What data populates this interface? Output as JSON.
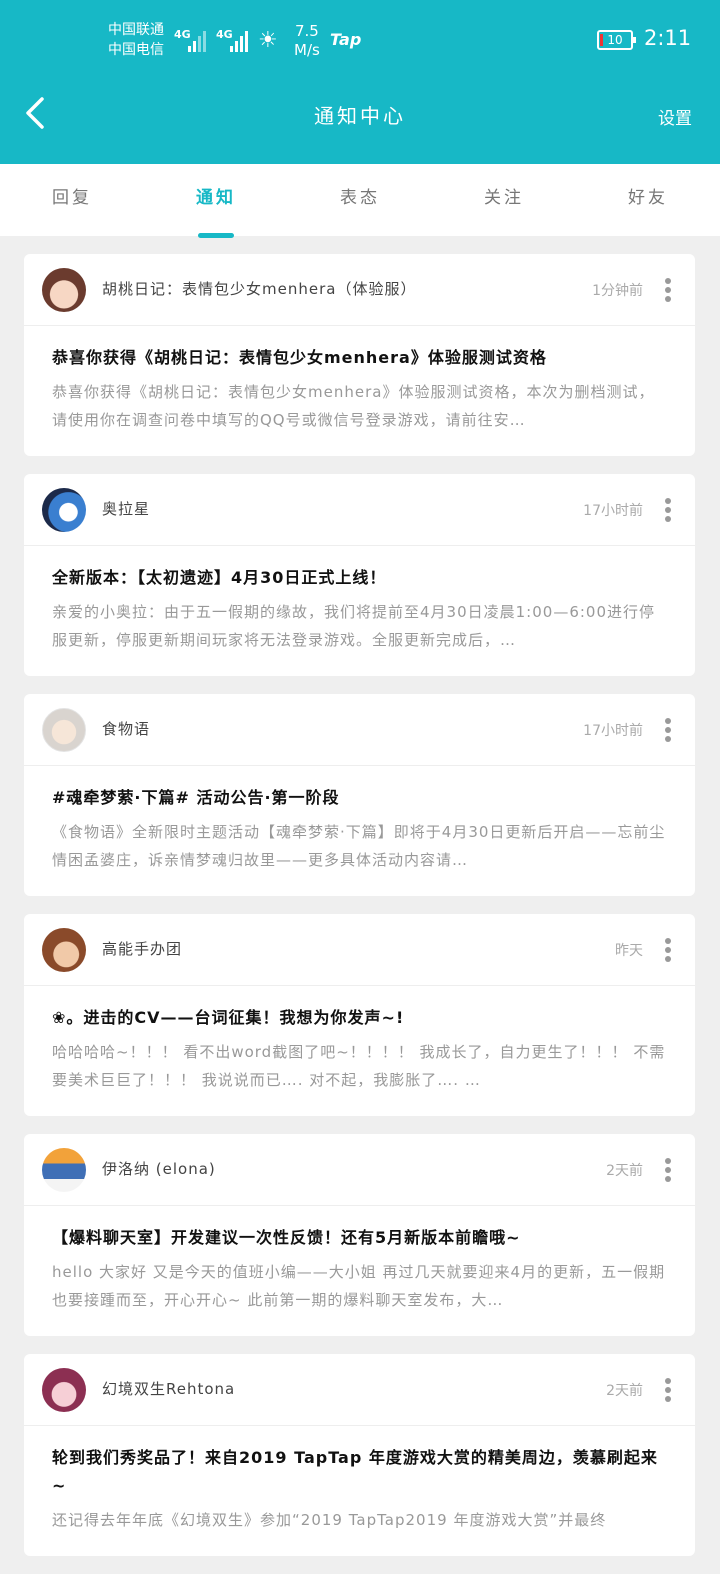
{
  "status_bar": {
    "carrier1": "中国联通",
    "carrier2": "中国电信",
    "sig1": "4G",
    "sig2": "4G",
    "speed_value": "7.5",
    "speed_unit": "M/s",
    "tap_label": "Tap",
    "battery": "10",
    "time": "2:11"
  },
  "header": {
    "back_icon": "chevron-left-icon",
    "title": "通知中心",
    "settings_label": "设置"
  },
  "tabs": [
    {
      "label": "回复"
    },
    {
      "label": "通知"
    },
    {
      "label": "表态"
    },
    {
      "label": "关注"
    },
    {
      "label": "好友"
    }
  ],
  "active_tab": "通知",
  "colors": {
    "accent": "#17b8c6"
  },
  "notifications": [
    {
      "sender": "胡桃日记：表情包少女menhera（体验服）",
      "time": "1分钟前",
      "title": "恭喜你获得《胡桃日记：表情包少女menhera》体验服测试资格",
      "text": "恭喜你获得《胡桃日记：表情包少女menhera》体验服测试资格，本次为删档测试，请使用你在调查问卷中填写的QQ号或微信号登录游戏，请前往安…"
    },
    {
      "sender": "奥拉星",
      "time": "17小时前",
      "title": "全新版本：【太初遗迹】4月30日正式上线！",
      "text": "亲爱的小奥拉：由于五一假期的缘故，我们将提前至4月30日凌晨1:00—6:00进行停服更新，停服更新期间玩家将无法登录游戏。全服更新完成后，…"
    },
    {
      "sender": "食物语",
      "time": "17小时前",
      "title": "#魂牵梦萦·下篇# 活动公告·第一阶段",
      "text": "《食物语》全新限时主题活动【魂牵梦萦·下篇】即将于4月30日更新后开启——忘前尘情困孟婆庄，诉亲情梦魂归故里——更多具体活动内容请…"
    },
    {
      "sender": "高能手办团",
      "time": "昨天",
      "title": "❀。进击的CV——台词征集！我想为你发声~!",
      "text": "哈哈哈哈~！！！ 看不出word截图了吧~！！！！ 我成长了，自力更生了！！！ 不需要美术巨巨了！！！ 我说说而已…. 对不起，我膨胀了…. …"
    },
    {
      "sender": "伊洛纳 (elona)",
      "time": "2天前",
      "title": "【爆料聊天室】开发建议一次性反馈！还有5月新版本前瞻哦~",
      "text": "hello 大家好 又是今天的值班小编——大小姐 再过几天就要迎来4月的更新，五一假期也要接踵而至，开心开心~ 此前第一期的爆料聊天室发布，大…"
    },
    {
      "sender": "幻境双生Rehtona",
      "time": "2天前",
      "title": "轮到我们秀奖品了！来自2019 TapTap 年度游戏大赏的精美周边，羡慕刷起来~",
      "text": "还记得去年年底《幻境双生》参加“2019 TapTap2019 年度游戏大赏”并最终"
    }
  ]
}
